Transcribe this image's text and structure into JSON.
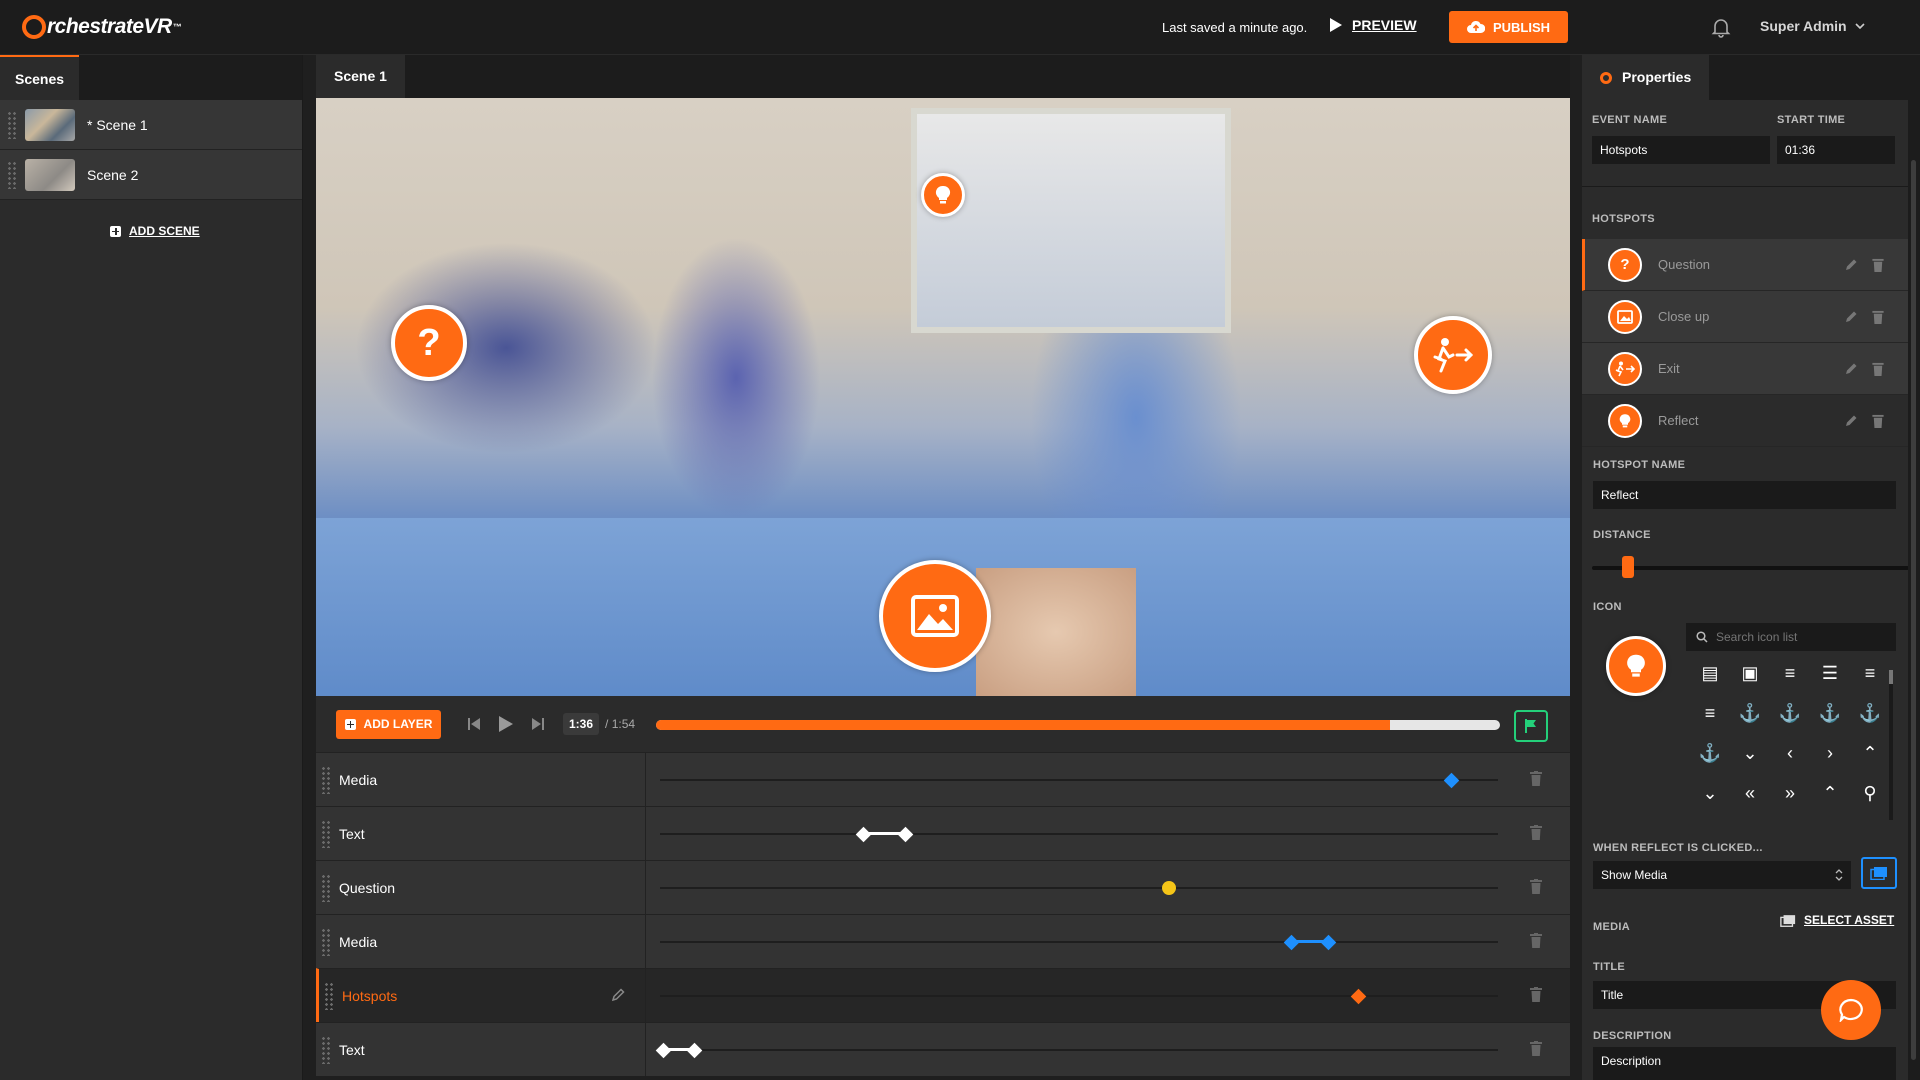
{
  "header": {
    "logo_text": "rchestrateVR",
    "logo_tm": "™",
    "saved_text": "Last saved a minute ago.",
    "preview_label": "PREVIEW",
    "publish_label": "PUBLISH",
    "user_name": "Super Admin"
  },
  "scenes_panel": {
    "tab_label": "Scenes",
    "items": [
      {
        "label": "* Scene 1"
      },
      {
        "label": "Scene 2"
      }
    ],
    "add_label": "ADD SCENE"
  },
  "editor": {
    "tab_label": "Scene 1",
    "hotspots": [
      {
        "icon": "question-icon",
        "glyph": "?"
      },
      {
        "icon": "exit-icon",
        "glyph": "🏃"
      },
      {
        "icon": "image-icon",
        "glyph": "🖼"
      },
      {
        "icon": "lightbulb-icon",
        "glyph": "💡"
      }
    ]
  },
  "timeline": {
    "add_layer_label": "ADD LAYER",
    "current_time": "1:36",
    "total_time": "/ 1:54",
    "progress": 0.87,
    "layers": [
      {
        "name": "Media",
        "active": false
      },
      {
        "name": "Text",
        "active": false
      },
      {
        "name": "Question",
        "active": false
      },
      {
        "name": "Media",
        "active": false
      },
      {
        "name": "Hotspots",
        "active": true
      },
      {
        "name": "Text",
        "active": false
      }
    ]
  },
  "properties": {
    "tab_label": "Properties",
    "event_name_label": "EVENT NAME",
    "event_name_value": "Hotspots",
    "start_time_label": "START TIME",
    "start_time_value": "01:36",
    "hotspots_label": "HOTSPOTS",
    "hotspots": [
      {
        "name": "Question",
        "glyph": "?"
      },
      {
        "name": "Close up",
        "glyph": "▣"
      },
      {
        "name": "Exit",
        "glyph": "➜"
      },
      {
        "name": "Reflect",
        "glyph": "💡"
      }
    ],
    "hotspot_name_label": "HOTSPOT NAME",
    "hotspot_name_value": "Reflect",
    "distance_label": "DISTANCE",
    "distance_value": 0.1,
    "icon_label": "ICON",
    "search_placeholder": "Search icon list",
    "icon_glyphs": [
      "▤",
      "▣",
      "≡",
      "☰",
      "≡",
      "≡",
      "⚓",
      "⚓",
      "⚓",
      "⚓",
      "⚓",
      "⌄",
      "‹",
      "›",
      "⌃",
      "⌄",
      "«",
      "»",
      "⌃",
      "⚲"
    ],
    "when_clicked_label": "WHEN REFLECT IS CLICKED...",
    "action_value": "Show Media",
    "media_label": "MEDIA",
    "select_asset_label": "SELECT ASSET",
    "title_label": "TITLE",
    "title_value": "Title",
    "description_label": "DESCRIPTION",
    "description_value": "Description"
  },
  "colors": {
    "accent": "#ff6a13",
    "keyframe_blue": "#1e90ff",
    "keyframe_yellow": "#f5c518",
    "flag_green": "#24d07a"
  }
}
